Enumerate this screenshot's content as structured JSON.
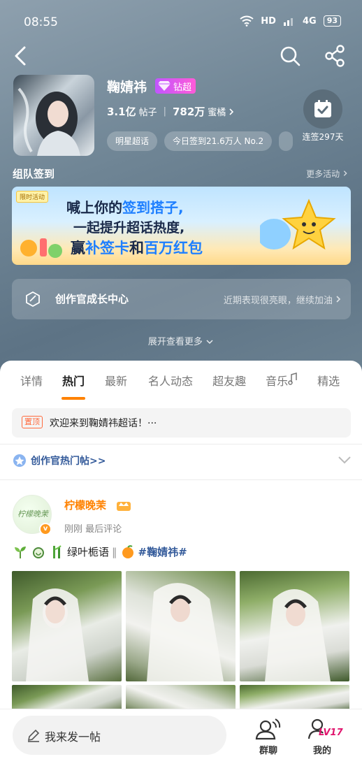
{
  "status_bar": {
    "time": "08:55",
    "network": "HD",
    "signal_label": "4G",
    "battery": "93"
  },
  "header": {
    "name": "鞠婧祎",
    "tier_label": "钻超",
    "posts_count": "3.1亿",
    "posts_label": "帖子",
    "fans_count": "782万",
    "fans_label": "蜜橘",
    "chips": [
      "明星超话",
      "今日签到21.6万人 No.2"
    ],
    "checkin_label": "连签297天"
  },
  "team": {
    "title": "组队签到",
    "more": "更多活动"
  },
  "banner": {
    "tag": "限时活动",
    "line1_a": "喊上你的",
    "line1_b": "签到搭子,",
    "line2": "一起提升超话热度,",
    "line3_a": "赢",
    "line3_b": "补签卡",
    "line3_c": "和",
    "line3_d": "百万红包"
  },
  "growth": {
    "label": "创作官成长中心",
    "tip": "近期表现很亮眼，继续加油"
  },
  "expand_label": "展开查看更多",
  "tabs": [
    "详情",
    "热门",
    "最新",
    "名人动态",
    "超友趣",
    "音乐",
    "精选"
  ],
  "active_tab": "热门",
  "pinned": {
    "badge": "置顶",
    "text": "欢迎来到鞠婧祎超话！···"
  },
  "hot_posts": {
    "text": "创作官热门帖>>"
  },
  "post": {
    "avatar_text": "柠檬晚茉",
    "author": "柠檬晚茉",
    "time": "刚刚",
    "meta": "最后评论",
    "text_plain": "绿叶栀语",
    "text_sep": "‖",
    "topic": "#鞠婧祎#"
  },
  "bottom": {
    "compose": "我来发一帖",
    "group": "群聊",
    "mine": "我的",
    "level": "LV17"
  },
  "colors": {
    "accent": "#ff8200",
    "topic": "#335a9a",
    "tier": "#c155ff"
  }
}
